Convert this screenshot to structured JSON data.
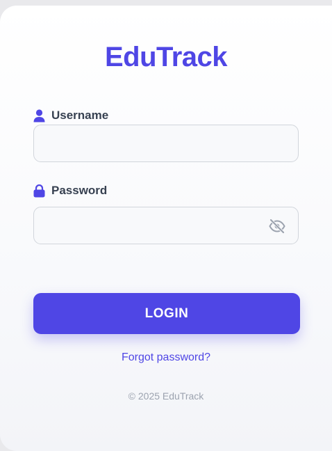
{
  "brand": {
    "name": "EduTrack",
    "color": "#4f46e5"
  },
  "form": {
    "username": {
      "label": "Username",
      "icon": "user-icon",
      "value": "",
      "placeholder": ""
    },
    "password": {
      "label": "Password",
      "icon": "lock-icon",
      "value": "",
      "placeholder": "",
      "toggle_icon": "eye-off-icon"
    },
    "submit_label": "LOGIN",
    "forgot_label": "Forgot password?"
  },
  "footer": {
    "copyright": "© 2025 EduTrack"
  }
}
